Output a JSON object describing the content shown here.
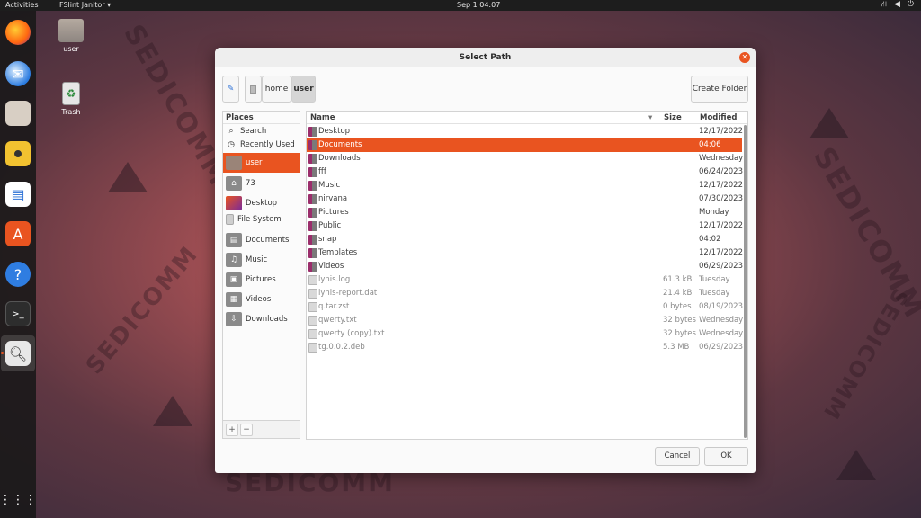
{
  "topbar": {
    "activities": "Activities",
    "app_menu": "FSlint Janitor ▾",
    "clock": "Sep 1  04:07",
    "tray_icons": [
      "network-icon",
      "volume-icon",
      "power-icon"
    ]
  },
  "desktop": {
    "icons": [
      {
        "label": "user",
        "icon": "home-folder-icon"
      },
      {
        "label": "Trash",
        "icon": "trash-icon"
      }
    ]
  },
  "dock": {
    "items": [
      "firefox-icon",
      "thunderbird-icon",
      "files-icon",
      "rhythmbox-icon",
      "writer-icon",
      "software-icon",
      "help-icon",
      "terminal-icon",
      "fslint-icon"
    ],
    "apps_grid": "show-applications-icon",
    "accent": "#e95420"
  },
  "dialog": {
    "title": "Select Path",
    "path": [
      "home",
      "user"
    ],
    "create_folder": "Create Folder",
    "cancel": "Cancel",
    "ok": "OK",
    "places_header": "Places",
    "places": [
      {
        "label": "Search",
        "icon": "search-icon"
      },
      {
        "label": "Recently Used",
        "icon": "clock-icon"
      },
      {
        "label": "user",
        "icon": "folder-icon",
        "selected": true
      },
      {
        "label": "73",
        "icon": "home-icon"
      },
      {
        "label": "Desktop",
        "icon": "desktop-icon"
      },
      {
        "label": "File System",
        "icon": "drive-icon"
      },
      {
        "label": "Documents",
        "icon": "documents-icon"
      },
      {
        "label": "Music",
        "icon": "music-icon"
      },
      {
        "label": "Pictures",
        "icon": "pictures-icon"
      },
      {
        "label": "Videos",
        "icon": "videos-icon"
      },
      {
        "label": "Downloads",
        "icon": "downloads-icon"
      }
    ],
    "columns": {
      "name": "Name",
      "size": "Size",
      "modified": "Modified"
    },
    "files": [
      {
        "name": "Desktop",
        "size": "",
        "modified": "12/17/2022",
        "type": "folder"
      },
      {
        "name": "Documents",
        "size": "",
        "modified": "04:06",
        "type": "folder",
        "selected": true
      },
      {
        "name": "Downloads",
        "size": "",
        "modified": "Wednesday",
        "type": "folder"
      },
      {
        "name": "fff",
        "size": "",
        "modified": "06/24/2023",
        "type": "folder"
      },
      {
        "name": "Music",
        "size": "",
        "modified": "12/17/2022",
        "type": "folder"
      },
      {
        "name": "nirvana",
        "size": "",
        "modified": "07/30/2023",
        "type": "folder"
      },
      {
        "name": "Pictures",
        "size": "",
        "modified": "Monday",
        "type": "folder"
      },
      {
        "name": "Public",
        "size": "",
        "modified": "12/17/2022",
        "type": "folder"
      },
      {
        "name": "snap",
        "size": "",
        "modified": "04:02",
        "type": "folder"
      },
      {
        "name": "Templates",
        "size": "",
        "modified": "12/17/2022",
        "type": "folder"
      },
      {
        "name": "Videos",
        "size": "",
        "modified": "06/29/2023",
        "type": "folder"
      },
      {
        "name": "lynis.log",
        "size": "61.3 kB",
        "modified": "Tuesday",
        "type": "file"
      },
      {
        "name": "lynis-report.dat",
        "size": "21.4 kB",
        "modified": "Tuesday",
        "type": "file"
      },
      {
        "name": "q.tar.zst",
        "size": "0 bytes",
        "modified": "08/19/2023",
        "type": "file"
      },
      {
        "name": "qwerty.txt",
        "size": "32 bytes",
        "modified": "Wednesday",
        "type": "file"
      },
      {
        "name": "qwerty (copy).txt",
        "size": "32 bytes",
        "modified": "Wednesday",
        "type": "file"
      },
      {
        "name": "tg.0.0.2.deb",
        "size": "5.3 MB",
        "modified": "06/29/2023",
        "type": "file"
      }
    ]
  }
}
